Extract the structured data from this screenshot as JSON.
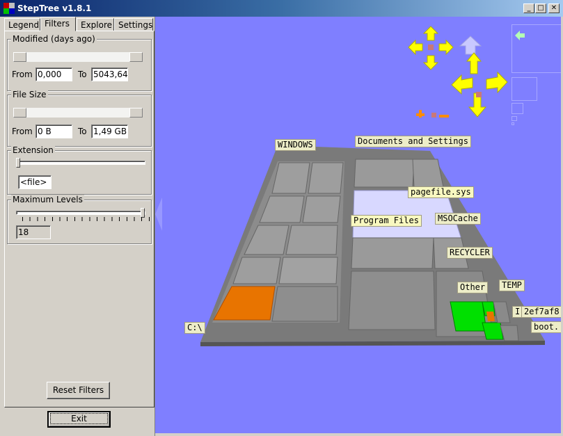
{
  "window": {
    "title": "StepTree v1.8.1",
    "controls": {
      "minimize": "_",
      "maximize": "□",
      "close": "✕"
    }
  },
  "tabs": [
    {
      "label": "Legend",
      "active": false
    },
    {
      "label": "Filters",
      "active": true
    },
    {
      "label": "Explore",
      "active": false
    },
    {
      "label": "Settings",
      "active": false
    }
  ],
  "filters": {
    "modified": {
      "title": "Modified (days ago)",
      "from_label": "From",
      "from_value": "0,000",
      "to_label": "To",
      "to_value": "5043,64",
      "range_low_fraction": 0.0,
      "range_high_fraction": 1.0
    },
    "file_size": {
      "title": "File Size",
      "from_label": "From",
      "from_value": "0 B",
      "to_label": "To",
      "to_value": "1,49 GB",
      "range_low_fraction": 0.0,
      "range_high_fraction": 1.0
    },
    "extension": {
      "title": "Extension",
      "value": "<file>",
      "slider_fraction": 0.0
    },
    "max_levels": {
      "title": "Maximum Levels",
      "value": "18",
      "slider_fraction": 1.0
    },
    "reset_label": "Reset Filters"
  },
  "exit_label": "Exit",
  "viewport": {
    "background": "#7f7fff",
    "nav_colors": {
      "arrow": "#ffff00",
      "up": "#c8c8ff",
      "zoom": "#ff8c00",
      "center": "#c87878",
      "back": "#b4ffb4"
    },
    "labels": [
      {
        "text": "WINDOWS"
      },
      {
        "text": "Documents and Settings"
      },
      {
        "text": "pagefile.sys"
      },
      {
        "text": "Program Files"
      },
      {
        "text": "MSOCache"
      },
      {
        "text": "RECYCLER"
      },
      {
        "text": "Other"
      },
      {
        "text": "TEMP"
      },
      {
        "text": "I"
      },
      {
        "text": "2ef7af8"
      },
      {
        "text": "boot."
      },
      {
        "text": "C:\\"
      }
    ]
  }
}
